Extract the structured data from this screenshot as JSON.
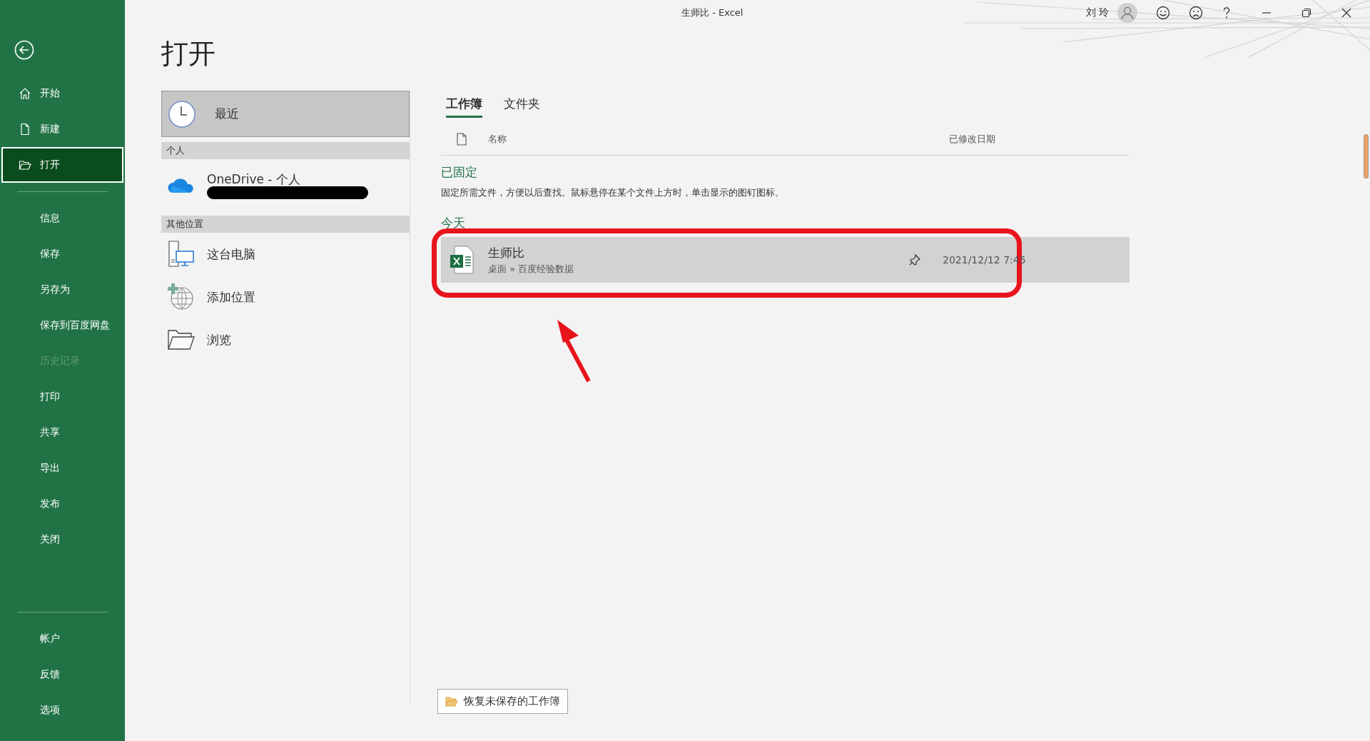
{
  "window": {
    "title": "生师比  -  Excel",
    "user": "刘 玲"
  },
  "sidebar": {
    "items": [
      {
        "label": "开始",
        "kind": "home",
        "selected": false,
        "disabled": false
      },
      {
        "label": "新建",
        "kind": "file",
        "selected": false,
        "disabled": false
      },
      {
        "label": "打开",
        "kind": "folder",
        "selected": true,
        "disabled": false
      },
      {
        "label": "信息",
        "selected": false,
        "disabled": false
      },
      {
        "label": "保存",
        "selected": false,
        "disabled": false
      },
      {
        "label": "另存为",
        "selected": false,
        "disabled": false
      },
      {
        "label": "保存到百度网盘",
        "selected": false,
        "disabled": false
      },
      {
        "label": "历史记录",
        "selected": false,
        "disabled": true
      },
      {
        "label": "打印",
        "selected": false,
        "disabled": false
      },
      {
        "label": "共享",
        "selected": false,
        "disabled": false
      },
      {
        "label": "导出",
        "selected": false,
        "disabled": false
      },
      {
        "label": "发布",
        "selected": false,
        "disabled": false
      },
      {
        "label": "关闭",
        "selected": false,
        "disabled": false
      }
    ],
    "bottom_items": [
      {
        "label": "帐户"
      },
      {
        "label": "反馈"
      },
      {
        "label": "选项"
      }
    ]
  },
  "page_title": "打开",
  "locations": {
    "recent": {
      "label": "最近",
      "selected": true
    },
    "sections": [
      {
        "heading": "个人",
        "items": [
          {
            "label": "OneDrive - 个人",
            "kind": "onedrive"
          }
        ]
      },
      {
        "heading": "其他位置",
        "items": [
          {
            "label": "这台电脑",
            "kind": "computer"
          },
          {
            "label": "添加位置",
            "kind": "add-place"
          },
          {
            "label": "浏览",
            "kind": "browse"
          }
        ]
      }
    ]
  },
  "tabs": [
    {
      "label": "工作簿",
      "selected": true
    },
    {
      "label": "文件夹",
      "selected": false
    }
  ],
  "columns": [
    "名称",
    "已修改日期"
  ],
  "pinned": {
    "heading": "已固定",
    "hint": "固定所需文件，方便以后查找。鼠标悬停在某个文件上方时，单击显示的图钉图标。"
  },
  "groups": [
    {
      "heading": "今天",
      "files": [
        {
          "name": "生师比",
          "path": "桌面 » 百度经验数据",
          "modified": "2021/12/12 7:45",
          "selected": true
        }
      ]
    }
  ],
  "recover_button": "恢复未保存的工作簿"
}
